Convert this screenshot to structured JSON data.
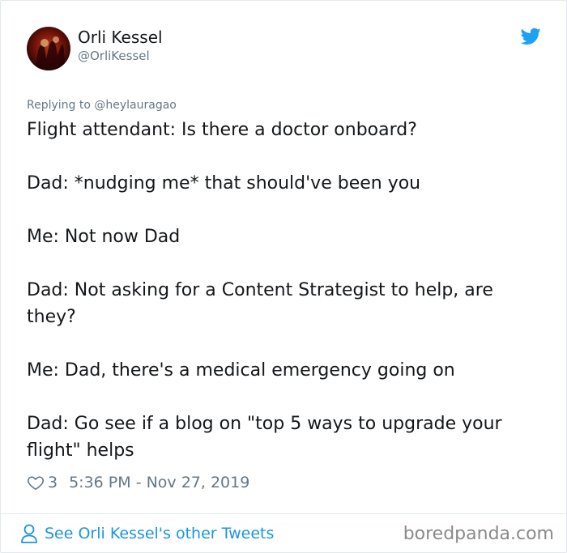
{
  "user": {
    "name": "Orli Kessel",
    "handle": "@OrliKessel"
  },
  "replying_to": "Replying to @heylauragao",
  "tweet_lines": [
    "Flight attendant: Is there a doctor onboard?",
    "Dad: *nudging me* that should've been you",
    "Me: Not now Dad",
    "Dad: Not asking for a Content Strategist to help, are they?",
    "Me: Dad, there's a medical emergency going on",
    "Dad: Go see if a blog on \"top 5 ways to upgrade your flight\" helps"
  ],
  "meta": {
    "likes": "3",
    "timestamp": "5:36 PM - Nov 27, 2019"
  },
  "footer": {
    "see_more": "See Orli Kessel's other Tweets",
    "watermark": "boredpanda.com"
  },
  "icons": {
    "bird": "twitter-bird-icon",
    "heart": "heart-icon",
    "person": "person-icon"
  },
  "colors": {
    "accent": "#1da1f2",
    "link": "#1b95e0",
    "muted": "#657786",
    "text": "#14171a"
  }
}
